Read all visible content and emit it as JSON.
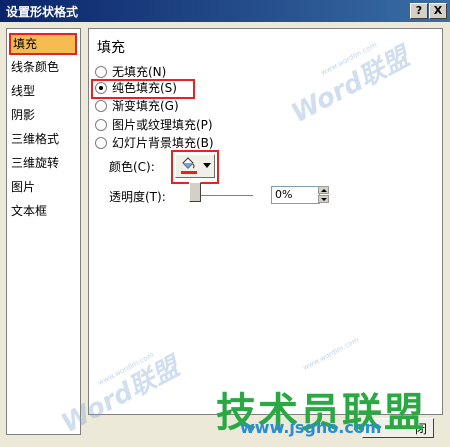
{
  "window": {
    "title": "设置形状格式",
    "help_glyph": "?",
    "close_glyph": "X"
  },
  "sidebar": {
    "items": [
      {
        "label": "填充"
      },
      {
        "label": "线条颜色"
      },
      {
        "label": "线型"
      },
      {
        "label": "阴影"
      },
      {
        "label": "三维格式"
      },
      {
        "label": "三维旋转"
      },
      {
        "label": "图片"
      },
      {
        "label": "文本框"
      }
    ]
  },
  "panel": {
    "title": "填充",
    "options": [
      {
        "label": "无填充(N)",
        "checked": false
      },
      {
        "label": "纯色填充(S)",
        "checked": true
      },
      {
        "label": "渐变填充(G)",
        "checked": false
      },
      {
        "label": "图片或纹理填充(P)",
        "checked": false
      },
      {
        "label": "幻灯片背景填充(B)",
        "checked": false
      }
    ],
    "color_label": "颜色(C):",
    "transparency_label": "透明度(T):",
    "transparency_value": "0%"
  },
  "footer": {
    "close_label": "闭"
  },
  "watermark": {
    "word": "Word联盟",
    "url": "www.wordlm.com",
    "brand": "技术员联盟",
    "brand_url": "www.jsgho.com"
  },
  "colors": {
    "highlight": "#e8221f",
    "selected_bg": "#f6bc51",
    "titlebar": "#0a246a"
  }
}
